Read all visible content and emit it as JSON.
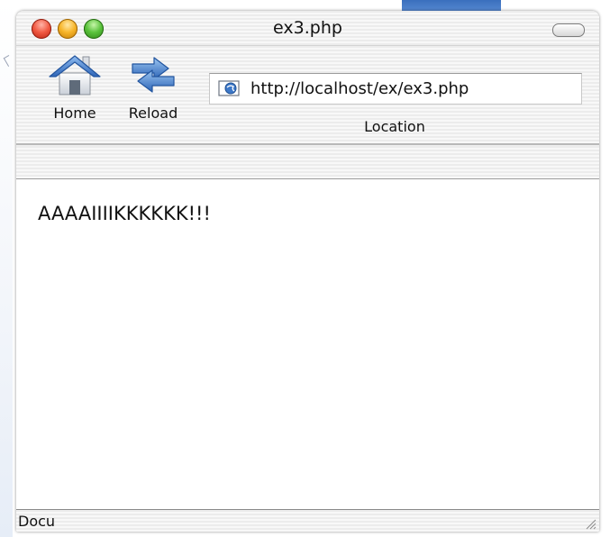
{
  "window": {
    "title": "ex3.php"
  },
  "toolbar": {
    "home_label": "Home",
    "reload_label": "Reload",
    "location_label": "Location",
    "location_url": "http://localhost/ex/ex3.php"
  },
  "content": {
    "text": "AAAAIIIIKKKKKK!!!"
  },
  "status": {
    "text": "Docu"
  },
  "icons": {
    "close": "close-icon",
    "minimize": "minimize-icon",
    "zoom": "zoom-icon",
    "toolbar_toggle": "toolbar-toggle-icon",
    "home": "home-icon",
    "reload": "reload-icon",
    "page": "page-icon",
    "resize": "resize-grip-icon"
  },
  "colors": {
    "close": "#f15a43",
    "minimize": "#f7b52a",
    "zoom": "#5ac23c",
    "icon_blue": "#3d78c8"
  }
}
